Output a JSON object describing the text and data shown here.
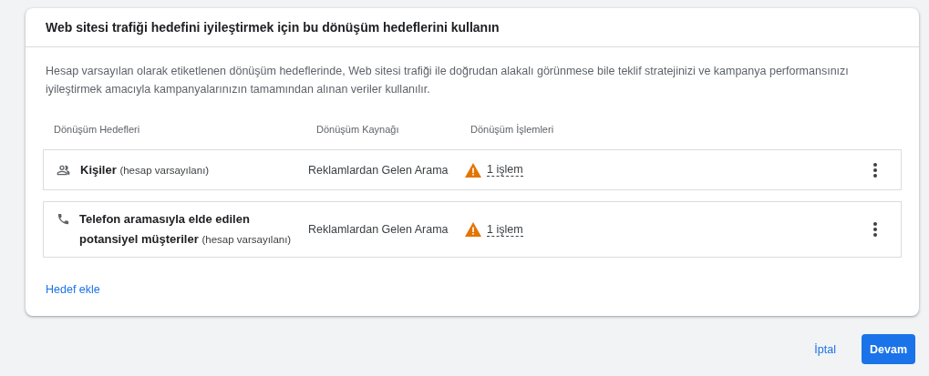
{
  "card": {
    "title": "Web sitesi trafiği hedefini iyileştirmek için bu dönüşüm hedeflerini kullanın",
    "description": "Hesap varsayılan olarak etiketlenen dönüşüm hedeflerinde, Web sitesi trafiği ile doğrudan alakalı görünmese bile teklif stratejinizi ve kampanya performansınızı iyileştirmek amacıyla kampanyalarınızın tamamından alınan veriler kullanılır.",
    "columns": [
      "Dönüşüm Hedefleri",
      "Dönüşüm Kaynağı",
      "Dönüşüm İşlemleri"
    ],
    "rows": [
      {
        "kind": "people",
        "goal": "Kişiler",
        "tag": "(hesap varsayılanı)",
        "source": "Reklamlardan Gelen Arama",
        "actions": "1 işlem"
      },
      {
        "kind": "phone",
        "goal": "Telefon aramasıyla elde edilen potansiyel müşteriler",
        "tag": "(hesap varsayılanı)",
        "source": "Reklamlardan Gelen Arama",
        "actions": "1 işlem"
      }
    ],
    "add_link": "Hedef ekle"
  },
  "buttons": {
    "cancel": "İptal",
    "continue": "Devam"
  }
}
